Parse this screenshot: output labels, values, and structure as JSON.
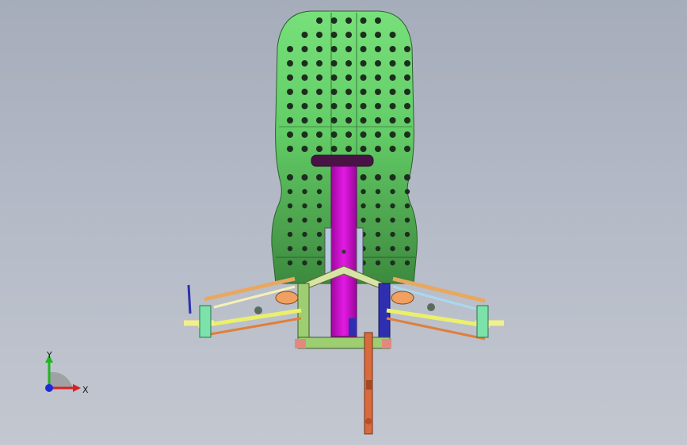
{
  "viewport": {
    "background_top": "#a6adba",
    "background_bottom": "#c3c7d0"
  },
  "model": {
    "seat_color": "#66d66a",
    "seat_dark": "#3a8a3c",
    "column_color": "#d10fd1",
    "frame_color": "#8fbf6a",
    "arm_colors": [
      "#e9e26a",
      "#f08a3a",
      "#2e2fb0",
      "#4fd1a3"
    ],
    "foot_color": "#d86a3c"
  },
  "triad": {
    "x_label": "X",
    "y_label": "Y",
    "x_color": "#d92121",
    "y_color": "#22b422",
    "z_color": "#1e2ad8"
  }
}
